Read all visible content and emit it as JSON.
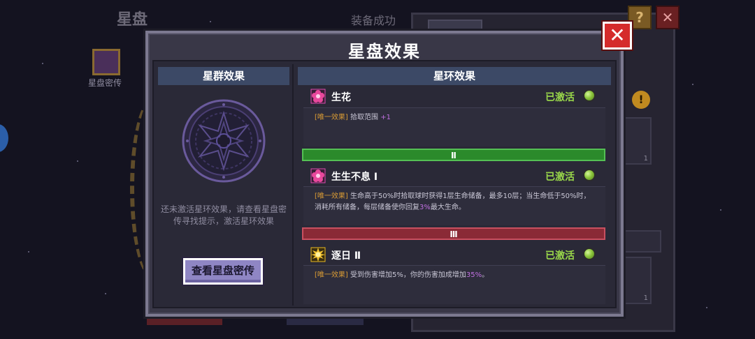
{
  "background": {
    "screen_title": "星盘",
    "status_text": "装备成功",
    "book_label": "星盘密传",
    "slot_counts": [
      "1",
      "1"
    ]
  },
  "modal": {
    "title": "星盘效果",
    "close_label": "✕",
    "left": {
      "header": "星群效果",
      "hint": "还未激活星环效果，请查看星盘密传寻找提示，激活星环效果",
      "button_label": "查看星盘密传"
    },
    "right": {
      "header": "星环效果",
      "effects": [
        {
          "icon": "flower-icon",
          "name": "生花",
          "status": "已激活",
          "tag": "[唯一效果]",
          "desc_a": "拾取范围",
          "highlight": "+1",
          "desc_b": ""
        },
        {
          "icon": "flower-icon",
          "name": "生生不息 Ⅰ",
          "status": "已激活",
          "tag": "[唯一效果]",
          "desc_a": "生命高于50%时拾取球时获得1层生命储备，最多10层；当生命低于50%时，消耗所有储备，每层储备使你回复",
          "highlight": "3%",
          "desc_b": "最大生命。"
        },
        {
          "icon": "sun-icon",
          "name": "逐日 Ⅱ",
          "status": "已激活",
          "tag": "[唯一效果]",
          "desc_a": "受到伤害增加5%，你的伤害加成增加",
          "highlight": "35%",
          "desc_b": "。"
        }
      ],
      "tiers": [
        "Ⅱ",
        "Ⅲ"
      ]
    }
  },
  "colors": {
    "active_green": "#9ad84a",
    "tier2": "#2b8a2b",
    "tier3": "#8a2a36",
    "highlight_purple": "#c070e0",
    "tag_orange": "#d89a34"
  }
}
